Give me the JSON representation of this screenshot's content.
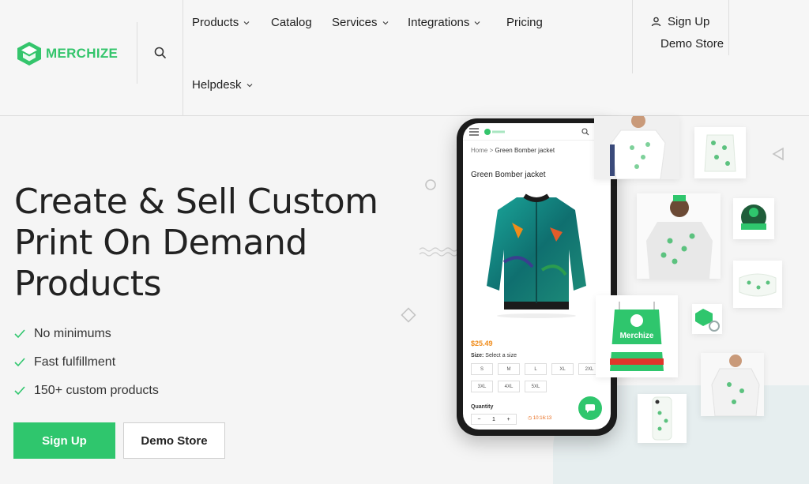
{
  "brand": {
    "logo_text": "MERCHIZE",
    "accent": "#2fc66d"
  },
  "nav": {
    "products": "Products",
    "catalog": "Catalog",
    "services": "Services",
    "integrations": "Integrations",
    "pricing": "Pricing",
    "helpdesk": "Helpdesk",
    "sign_up": "Sign Up",
    "demo_store": "Demo Store"
  },
  "hero": {
    "title_line1": "Create & Sell Custom",
    "title_line2": "Print On Demand",
    "title_line3": "Products",
    "features": [
      "No minimums",
      "Fast fulfillment",
      "150+ custom products"
    ],
    "primary_button": "Sign Up",
    "secondary_button": "Demo Store"
  },
  "phone": {
    "breadcrumb_home": "Home",
    "breadcrumb_sep": ">",
    "breadcrumb_current": "Green Bomber jacket",
    "product_title": "Green Bomber jacket",
    "price": "$25.49",
    "size_label": "Size:",
    "size_hint": "Select a size",
    "sizes": [
      "S",
      "M",
      "L",
      "XL",
      "2XL",
      "3XL",
      "4XL",
      "5XL"
    ],
    "quantity_label": "Quantity",
    "qty_minus": "−",
    "qty_value": "1",
    "qty_plus": "+",
    "timer": "10:16:13"
  },
  "cards": {
    "bag_text": "Merchize"
  }
}
